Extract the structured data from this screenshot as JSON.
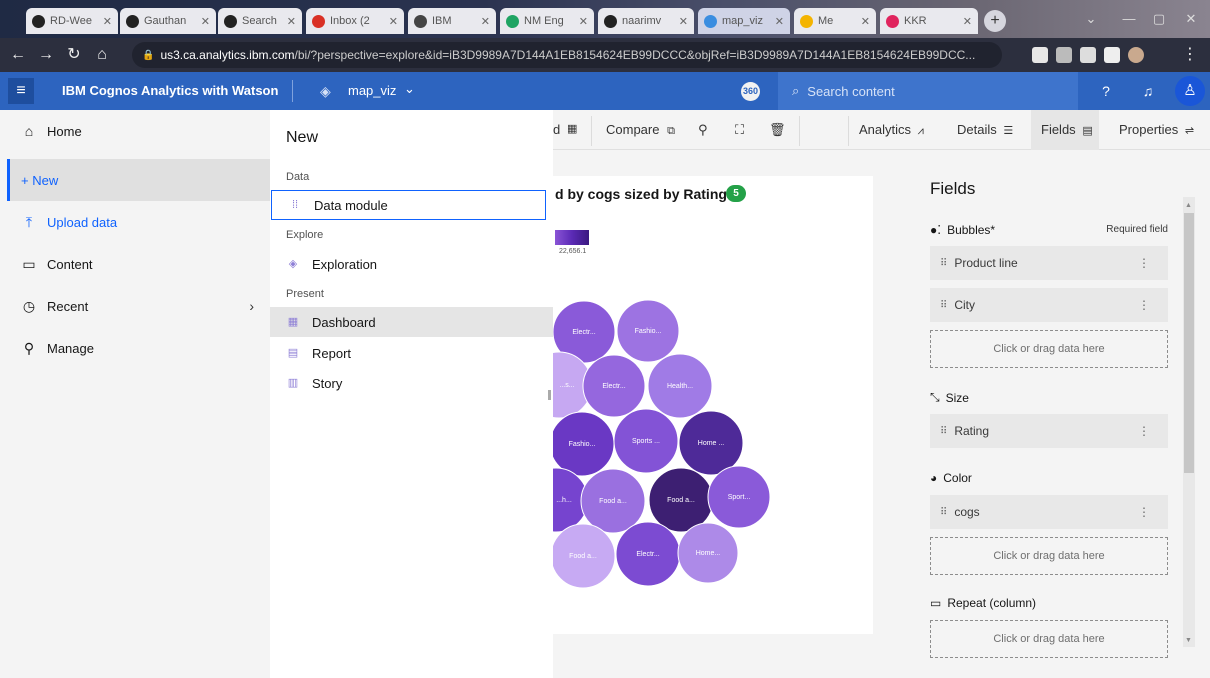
{
  "browser": {
    "tabs": [
      {
        "title": "RD-Wee",
        "color": "#222"
      },
      {
        "title": "Gauthan",
        "color": "#222"
      },
      {
        "title": "Search",
        "color": "#222"
      },
      {
        "title": "Inbox (2",
        "color": "#d93025"
      },
      {
        "title": "IBM",
        "color": "#333"
      },
      {
        "title": "NM Eng",
        "color": "#1fa463"
      },
      {
        "title": "naarimv",
        "color": "#222"
      },
      {
        "title": "map_viz",
        "color": "#3a8de0"
      },
      {
        "title": "Me",
        "color": "#f4b400"
      },
      {
        "title": "KKR",
        "color": "#e0245e"
      }
    ],
    "url_host": "us3.ca.analytics.ibm.com",
    "url_path": "/bi/?perspective=explore&id=iB3D9989A7D144A1EB8154624EB99DCCC&objRef=iB3D9989A7D144A1EB8154624EB99DCC..."
  },
  "header": {
    "app_name": "IBM Cognos Analytics with Watson",
    "viz_name": "map_viz",
    "badge": "360",
    "search_placeholder": "Search content"
  },
  "nav": {
    "home": "Home",
    "new": "+ New",
    "upload": "Upload data",
    "content": "Content",
    "recent": "Recent",
    "manage": "Manage"
  },
  "flyout": {
    "title": "New",
    "sec_data": "Data",
    "data_module": "Data module",
    "sec_explore": "Explore",
    "exploration": "Exploration",
    "sec_present": "Present",
    "dashboard": "Dashboard",
    "report": "Report",
    "story": "Story"
  },
  "toolbar": {
    "d_partial": "d",
    "compare": "Compare",
    "analytics": "Analytics",
    "details": "Details",
    "fields": "Fields",
    "properties": "Properties"
  },
  "visual": {
    "title_partial": "d by cogs sized by Rating",
    "count": "5",
    "legend_value": "22,656.1",
    "bubbles": [
      {
        "label": "Electr...",
        "color": "#8a5ad9"
      },
      {
        "label": "Fashio...",
        "color": "#9d73e2"
      },
      {
        "label": "...s...",
        "color": "#c6a8f2"
      },
      {
        "label": "Electr...",
        "color": "#9567de"
      },
      {
        "label": "Health...",
        "color": "#a07be6"
      },
      {
        "label": "Fashio...",
        "color": "#6a38c4"
      },
      {
        "label": "Sports ...",
        "color": "#8353d6"
      },
      {
        "label": "Home ...",
        "color": "#4e2a98"
      },
      {
        "label": "...h...",
        "color": "#7644cf"
      },
      {
        "label": "Food a...",
        "color": "#9a70e0"
      },
      {
        "label": "Food a...",
        "color": "#3d1f72"
      },
      {
        "label": "Sport...",
        "color": "#8a5ad9"
      },
      {
        "label": "Food a...",
        "color": "#c7aaf3"
      },
      {
        "label": "Electr...",
        "color": "#7c4bd2"
      },
      {
        "label": "Home...",
        "color": "#ad8ae8"
      }
    ]
  },
  "fields": {
    "title": "Fields",
    "bubbles_label": "Bubbles*",
    "required": "Required field",
    "product_line": "Product line",
    "city": "City",
    "drop": "Click or drag data here",
    "size_label": "Size",
    "rating": "Rating",
    "color_label": "Color",
    "cogs": "cogs",
    "repeat_label": "Repeat (column)"
  }
}
